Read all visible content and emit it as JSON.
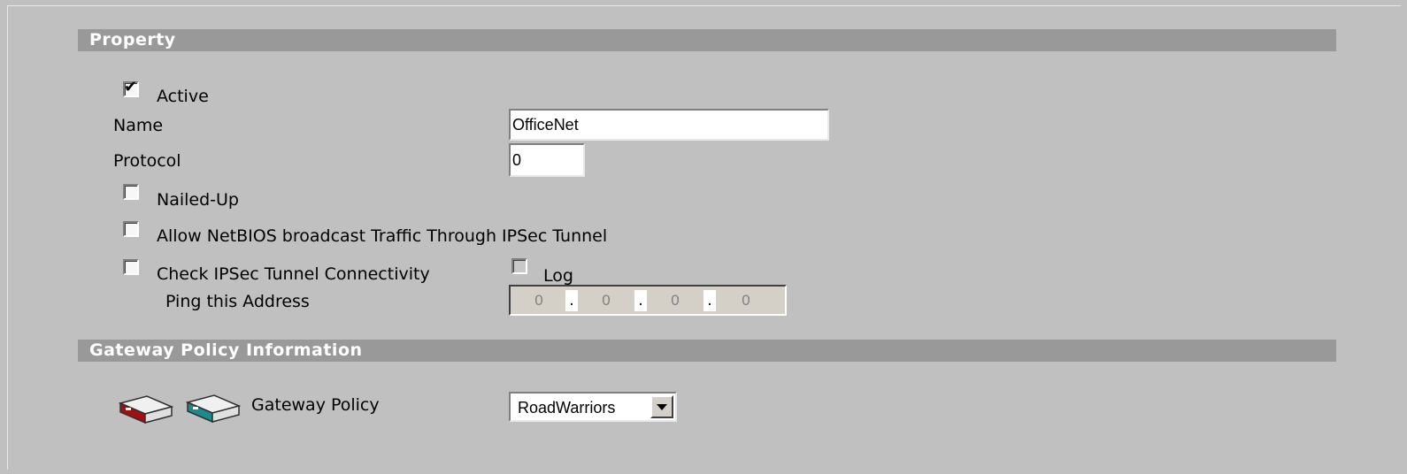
{
  "property": {
    "header": "Property",
    "active": {
      "label": "Active",
      "checked": true
    },
    "name": {
      "label": "Name",
      "value": "OfficeNet"
    },
    "protocol": {
      "label": "Protocol",
      "value": "0"
    },
    "nailed_up": {
      "label": "Nailed-Up",
      "checked": false
    },
    "netbios": {
      "label": "Allow NetBIOS broadcast Traffic Through IPSec Tunnel",
      "checked": false
    },
    "connectivity": {
      "label": "Check IPSec Tunnel Connectivity",
      "checked": false
    },
    "log": {
      "label": "Log",
      "checked": false
    },
    "ping": {
      "label": "Ping this Address",
      "octets": [
        "0",
        "0",
        "0",
        "0"
      ],
      "separator": "."
    }
  },
  "gateway": {
    "header": "Gateway Policy Information",
    "policy_label": "Gateway Policy",
    "selected": "RoadWarriors",
    "icons": [
      "router-red-icon",
      "router-teal-icon"
    ]
  },
  "colors": {
    "background": "#c0c0c0",
    "header_bar": "#999999",
    "router_red": "#a01010",
    "router_teal": "#1a8a8a"
  }
}
